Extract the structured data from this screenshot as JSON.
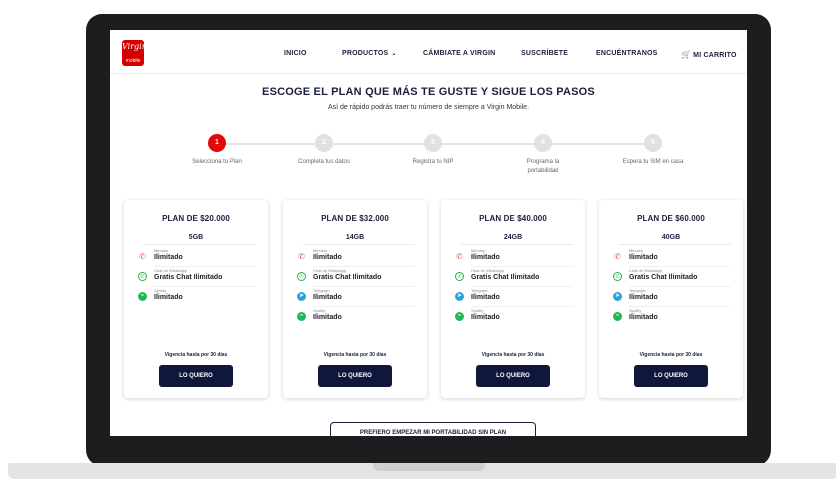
{
  "brand": {
    "logo_text": "Virgin",
    "logo_sub": "mobile"
  },
  "nav": {
    "items": [
      "INICIO",
      "PRODUCTOS",
      "CÁMBIATE A VIRGIN",
      "SUSCRÍBETE",
      "ENCUÉNTRANOS"
    ],
    "cart": "MI CARRITO"
  },
  "hero": {
    "title": "ESCOGE EL PLAN QUE MÁS TE GUSTE Y SIGUE LOS PASOS",
    "subtitle": "Así de rápido podrás traer tu número de siempre a Virgin Mobile."
  },
  "steps": [
    {
      "num": "1",
      "label": "Selecciona tu Plan",
      "active": true
    },
    {
      "num": "2",
      "label": "Completa tus datos",
      "active": false
    },
    {
      "num": "3",
      "label": "Registra tu NIP",
      "active": false
    },
    {
      "num": "4",
      "label": "Programa la portabilidad",
      "active": false
    },
    {
      "num": "5",
      "label": "Espera tu SIM en casa",
      "active": false
    }
  ],
  "plans": [
    {
      "title": "PLAN DE $20.000",
      "data": "5GB",
      "features": [
        {
          "icon": "phone-icon",
          "small": "Minutos",
          "value": "Ilimitado"
        },
        {
          "icon": "whatsapp-icon",
          "small": "Chat de Whatsapp",
          "value": "Gratis Chat Ilimitado"
        },
        {
          "icon": "spotify-icon",
          "small": "Spotify",
          "value": "Ilimitado"
        }
      ],
      "validity": "Vigencia hasta por 30 días",
      "button": "LO QUIERO"
    },
    {
      "title": "PLAN DE $32.000",
      "data": "14GB",
      "features": [
        {
          "icon": "phone-icon",
          "small": "Minutos",
          "value": "Ilimitado"
        },
        {
          "icon": "whatsapp-icon",
          "small": "Chat de Whatsapp",
          "value": "Gratis Chat Ilimitado"
        },
        {
          "icon": "telegram-icon",
          "small": "Telegram",
          "value": "Ilimitado"
        },
        {
          "icon": "spotify-icon",
          "small": "Spotify",
          "value": "Ilimitado"
        }
      ],
      "validity": "Vigencia hasta por 30 días",
      "button": "LO QUIERO"
    },
    {
      "title": "PLAN DE $40.000",
      "data": "24GB",
      "features": [
        {
          "icon": "phone-icon",
          "small": "Minutos",
          "value": "Ilimitado"
        },
        {
          "icon": "whatsapp-icon",
          "small": "Chat de Whatsapp",
          "value": "Gratis Chat Ilimitado"
        },
        {
          "icon": "telegram-icon",
          "small": "Telegram",
          "value": "Ilimitado"
        },
        {
          "icon": "spotify-icon",
          "small": "Spotify",
          "value": "Ilimitado"
        }
      ],
      "validity": "Vigencia hasta por 30 días",
      "button": "LO QUIERO"
    },
    {
      "title": "PLAN DE $60.000",
      "data": "40GB",
      "features": [
        {
          "icon": "phone-icon",
          "small": "Minutos",
          "value": "Ilimitado"
        },
        {
          "icon": "whatsapp-icon",
          "small": "Chat de Whatsapp",
          "value": "Gratis Chat Ilimitado"
        },
        {
          "icon": "telegram-icon",
          "small": "Telegram",
          "value": "Ilimitado"
        },
        {
          "icon": "spotify-icon",
          "small": "Spotify",
          "value": "Ilimitado"
        }
      ],
      "validity": "Vigencia hasta por 30 días",
      "button": "LO QUIERO"
    }
  ],
  "bottom_button": "PREFIERO EMPEZAR MI PORTABILIDAD SIN PLAN",
  "colors": {
    "navy": "#10173d",
    "accent_red": "#e10a0a",
    "brand_red": "#d30000"
  }
}
